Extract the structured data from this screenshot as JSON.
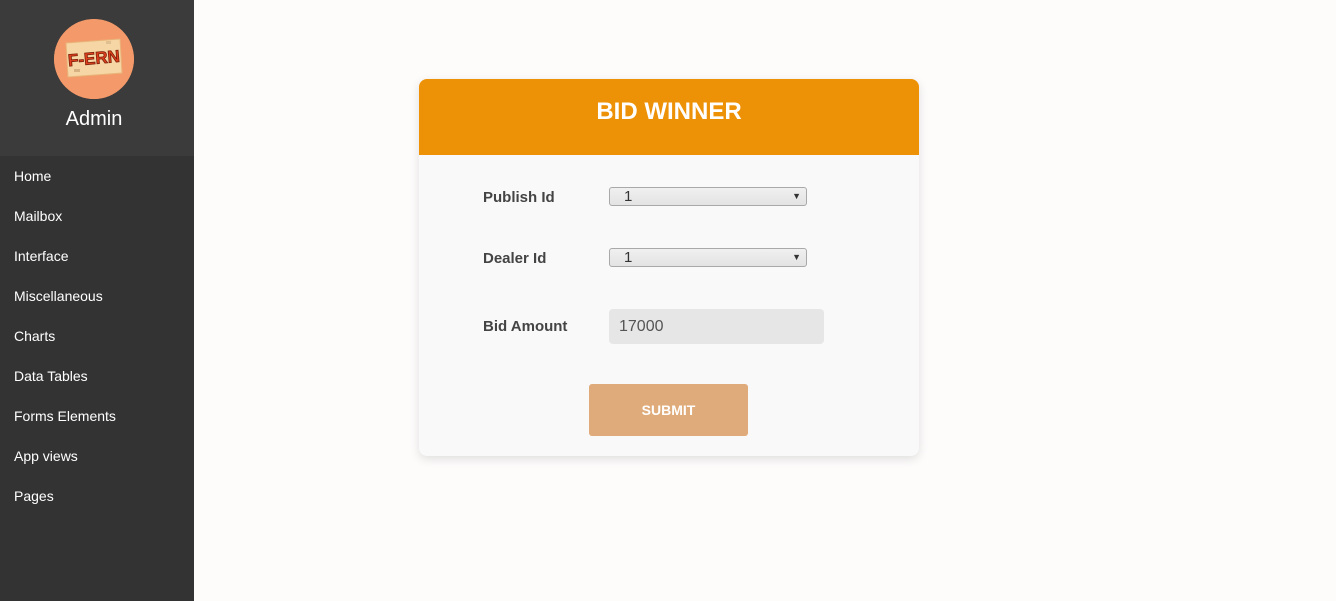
{
  "sidebar": {
    "logo_text": "F-ERN",
    "user_name": "Admin",
    "items": [
      {
        "label": "Home"
      },
      {
        "label": "Mailbox"
      },
      {
        "label": "Interface"
      },
      {
        "label": "Miscellaneous"
      },
      {
        "label": "Charts"
      },
      {
        "label": "Data Tables"
      },
      {
        "label": "Forms Elements"
      },
      {
        "label": "App views"
      },
      {
        "label": "Pages"
      }
    ]
  },
  "form": {
    "title": "BID WINNER",
    "publish_id": {
      "label": "Publish Id",
      "value": "1"
    },
    "dealer_id": {
      "label": "Dealer Id",
      "value": "1"
    },
    "bid_amount": {
      "label": "Bid Amount",
      "value": "17000"
    },
    "submit_label": "SUBMIT"
  },
  "colors": {
    "sidebar_bg": "#333333",
    "header_bg": "#ed9106",
    "submit_bg": "#e0ab7a",
    "page_bg": "#fdfcfb"
  }
}
